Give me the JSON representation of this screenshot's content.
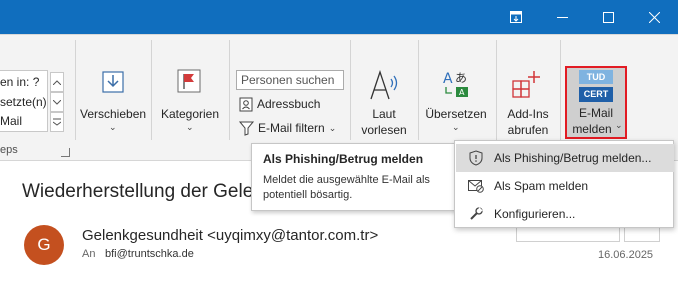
{
  "colors": {
    "titlebar": "#106ebe",
    "highlight_border": "#e21b23",
    "avatar": "#c4501f",
    "cert_blue": "#1f5fa8",
    "tud_blue": "#7fb3e0",
    "hover_gray": "#dcdcdc"
  },
  "window": {
    "buttons": [
      "restore-down-icon",
      "minimize-icon",
      "maximize-icon",
      "close-icon"
    ]
  },
  "quicksteps": {
    "lines": [
      "en in: ?",
      "setzte(n)",
      "Mail"
    ],
    "group_label": "eps"
  },
  "ribbon": {
    "move_label": "Verschieben",
    "categorize_label": "Kategorien",
    "search_placeholder": "Personen suchen",
    "addressbook_label": "Adressbuch",
    "filter_label": "E-Mail filtern",
    "read_aloud_line1": "Laut",
    "read_aloud_line2": "vorlesen",
    "translate_label": "Übersetzen",
    "addins_line1": "Add-Ins",
    "addins_line2": "abrufen",
    "report_icon_top": "TUD",
    "report_icon_bottom": "CERT",
    "report_line1": "E-Mail",
    "report_line2": "melden"
  },
  "email": {
    "subject": "Wiederherstellung der Gelen",
    "avatar_letter": "G",
    "sender": "Gelenkgesundheit <uyqimxy@tantor.com.tr>",
    "to_label": "An",
    "to_value": "bfi@truntschka.de",
    "date": "16.06.2025"
  },
  "tooltip": {
    "title": "Als Phishing/Betrug melden",
    "description": "Meldet die ausgewählte E-Mail als potentiell bösartig."
  },
  "dropdown": {
    "items": [
      {
        "label": "Als Phishing/Betrug melden...",
        "icon": "shield-alert-icon"
      },
      {
        "label": "Als Spam melden",
        "icon": "spam-mail-icon"
      },
      {
        "label": "Konfigurieren...",
        "icon": "wrench-icon"
      }
    ]
  }
}
